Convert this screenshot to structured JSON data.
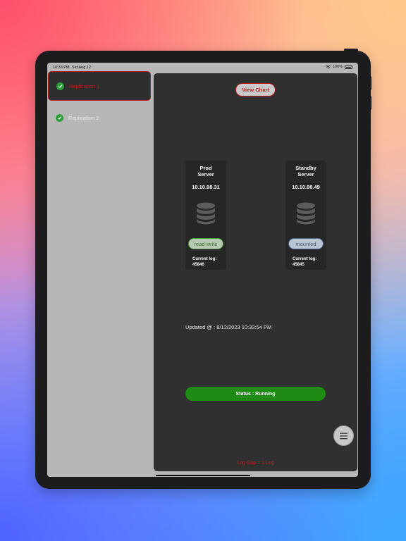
{
  "status_bar": {
    "time": "10:33 PM",
    "date": "Sat Aug 12",
    "battery": "100%"
  },
  "sidebar": {
    "items": [
      {
        "label": "Replication 1",
        "selected": true
      },
      {
        "label": "Replication 2",
        "selected": false
      }
    ]
  },
  "detail": {
    "view_chart_label": "View Chart",
    "servers": [
      {
        "name": "Prod\nServer",
        "ip": "10.10.98.31",
        "mode": "read write",
        "log_label": "Current log:",
        "log_value": "45846"
      },
      {
        "name": "Standby\nServer",
        "ip": "10.10.98.49",
        "mode": "mounted",
        "log_label": "Current log:",
        "log_value": "45845"
      }
    ],
    "updated_text": "Updated @ : 8/12/2023 10:33:54 PM",
    "status_text": "Status : Running",
    "footer_text": "Log Gap = 1 Log"
  },
  "colors": {
    "accent_red": "#c21d1d",
    "status_green": "#1f8a14",
    "check_green": "#2e9e3b"
  },
  "icons": [
    "wifi-icon",
    "battery-icon",
    "checkmark-icon",
    "database-icon",
    "menu-icon"
  ]
}
